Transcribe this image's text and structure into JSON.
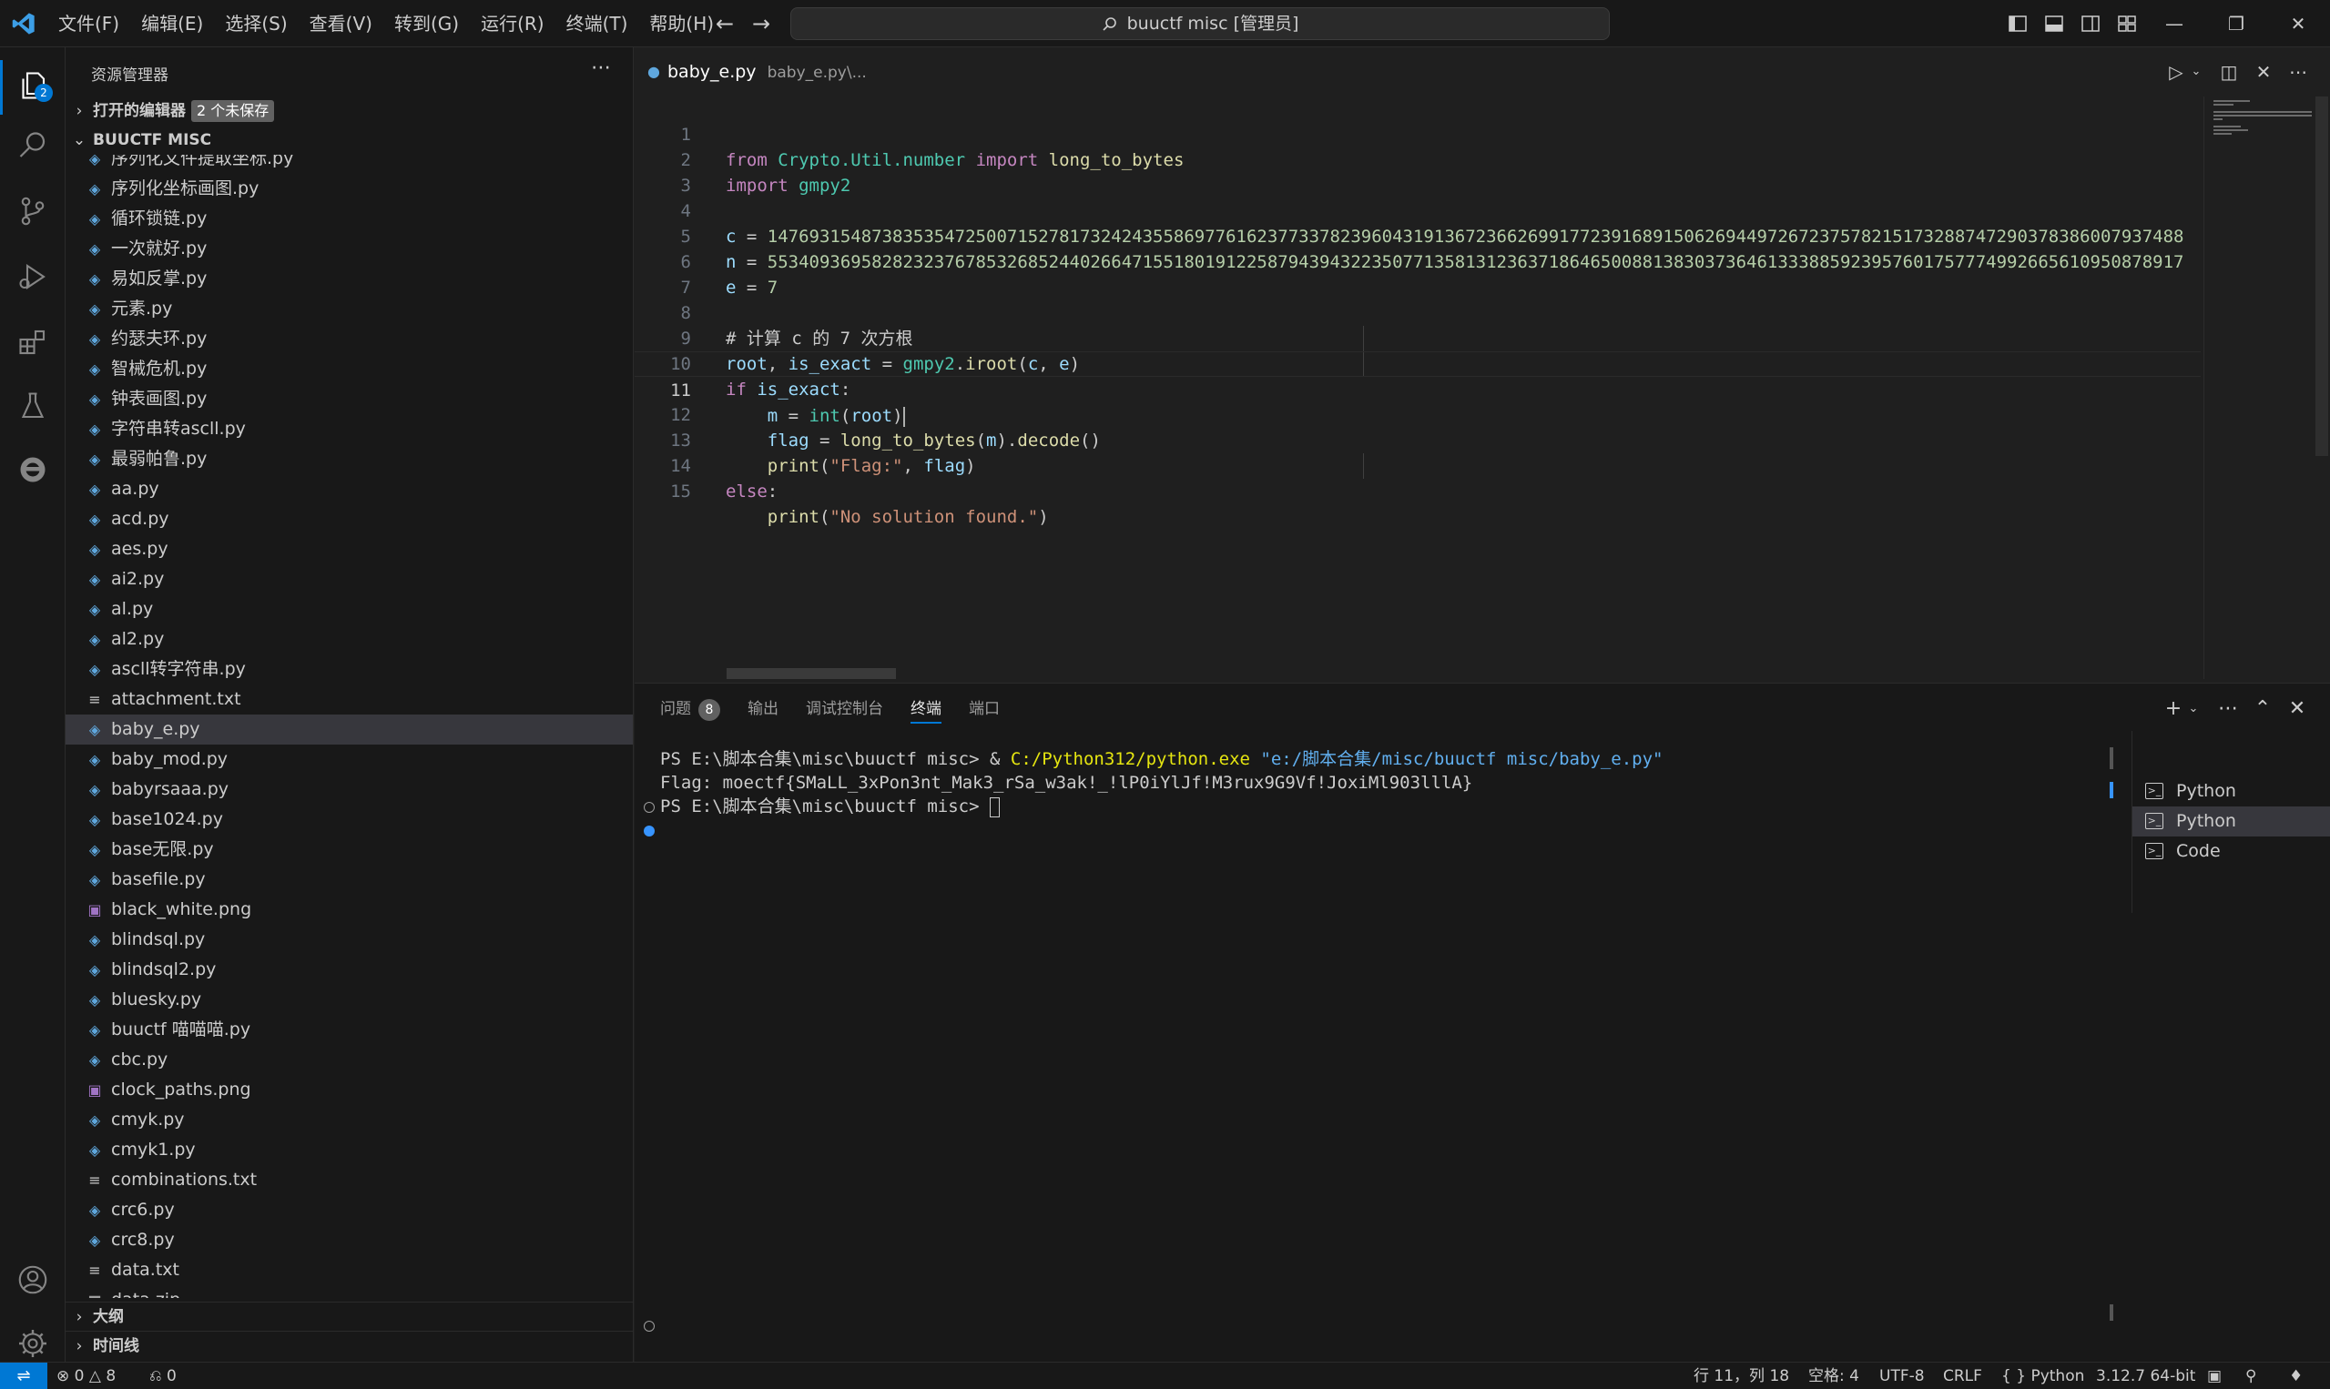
{
  "titlebar": {
    "menus": [
      "文件(F)",
      "编辑(E)",
      "选择(S)",
      "查看(V)",
      "转到(G)",
      "运行(R)",
      "终端(T)",
      "帮助(H)"
    ],
    "search": "buuctf misc [管理员]"
  },
  "activity": {
    "explorer_badge": "2"
  },
  "sidebar": {
    "title": "资源管理器",
    "open_editors": "打开的编辑器",
    "unsaved": "2 个未保存",
    "folder": "BUUCTF MISC",
    "files": [
      {
        "name": "序列化文件提取坐标.py",
        "type": "py"
      },
      {
        "name": "序列化坐标画图.py",
        "type": "py"
      },
      {
        "name": "循环锁链.py",
        "type": "py"
      },
      {
        "name": "一次就好.py",
        "type": "py"
      },
      {
        "name": "易如反掌.py",
        "type": "py"
      },
      {
        "name": "元素.py",
        "type": "py"
      },
      {
        "name": "约瑟夫环.py",
        "type": "py"
      },
      {
        "name": "智械危机.py",
        "type": "py"
      },
      {
        "name": "钟表画图.py",
        "type": "py"
      },
      {
        "name": "字符串转ascll.py",
        "type": "py"
      },
      {
        "name": "最弱帕鲁.py",
        "type": "py"
      },
      {
        "name": "aa.py",
        "type": "py"
      },
      {
        "name": "acd.py",
        "type": "py"
      },
      {
        "name": "aes.py",
        "type": "py"
      },
      {
        "name": "ai2.py",
        "type": "py"
      },
      {
        "name": "al.py",
        "type": "py"
      },
      {
        "name": "al2.py",
        "type": "py"
      },
      {
        "name": "ascll转字符串.py",
        "type": "py"
      },
      {
        "name": "attachment.txt",
        "type": "txt"
      },
      {
        "name": "baby_e.py",
        "type": "py",
        "selected": true
      },
      {
        "name": "baby_mod.py",
        "type": "py"
      },
      {
        "name": "babyrsaaa.py",
        "type": "py"
      },
      {
        "name": "base1024.py",
        "type": "py"
      },
      {
        "name": "base无限.py",
        "type": "py"
      },
      {
        "name": "basefile.py",
        "type": "py"
      },
      {
        "name": "black_white.png",
        "type": "png"
      },
      {
        "name": "blindsql.py",
        "type": "py"
      },
      {
        "name": "blindsql2.py",
        "type": "py"
      },
      {
        "name": "bluesky.py",
        "type": "py"
      },
      {
        "name": "buuctf 喵喵喵.py",
        "type": "py"
      },
      {
        "name": "cbc.py",
        "type": "py"
      },
      {
        "name": "clock_paths.png",
        "type": "png"
      },
      {
        "name": "cmyk.py",
        "type": "py"
      },
      {
        "name": "cmyk1.py",
        "type": "py"
      },
      {
        "name": "combinations.txt",
        "type": "txt"
      },
      {
        "name": "crc6.py",
        "type": "py"
      },
      {
        "name": "crc8.py",
        "type": "py"
      },
      {
        "name": "data.txt",
        "type": "txt"
      },
      {
        "name": "data.zip",
        "type": "zip"
      }
    ],
    "outline": "大纲",
    "timeline": "时间线"
  },
  "editor": {
    "tab_name": "baby_e.py",
    "tab_path": "baby_e.py\\...",
    "line_numbers": [
      "1",
      "2",
      "3",
      "4",
      "5",
      "6",
      "7",
      "8",
      "9",
      "10",
      "11",
      "12",
      "13",
      "14",
      "15"
    ],
    "c_value": "1476931548738353547250071527817324243558697761623773378239604319136723662699177239168915062694497267237578215173288747290378386007937488",
    "n_value": "5534093695828232376785326852440266471551801912258794394322350771358131236371864650088138303736461333885923957601757774992665610950878917",
    "e_value": "7",
    "comment": "# 计算 c 的 7 次方根",
    "str_flag": "\"Flag:\"",
    "str_nosol": "\"No solution found.\""
  },
  "panel": {
    "tabs": [
      "问题",
      "输出",
      "调试控制台",
      "终端",
      "端口"
    ],
    "problems_count": "8",
    "terminal_lines": {
      "prompt1": "PS E:\\脚本合集\\misc\\buuctf misc> ",
      "cmd_amp": "& ",
      "cmd_exe": "C:/Python312/python.exe",
      "cmd_arg": " \"e:/脚本合集/misc/buuctf misc/baby_e.py\"",
      "output": "Flag: moectf{SMaLL_3xPon3nt_Mak3_rSa_w3ak!_!lP0iYlJf!M3rux9G9Vf!JoxiMl903lllA}",
      "prompt2": "PS E:\\脚本合集\\misc\\buuctf misc> "
    },
    "terminals": [
      "Python",
      "Python",
      "Code"
    ]
  },
  "statusbar": {
    "errors": "0",
    "warnings": "8",
    "ports": "0",
    "position": "行 11，列 18",
    "spaces": "空格: 4",
    "encoding": "UTF-8",
    "eol": "CRLF",
    "language": "Python",
    "interpreter": "3.12.7 64-bit"
  }
}
